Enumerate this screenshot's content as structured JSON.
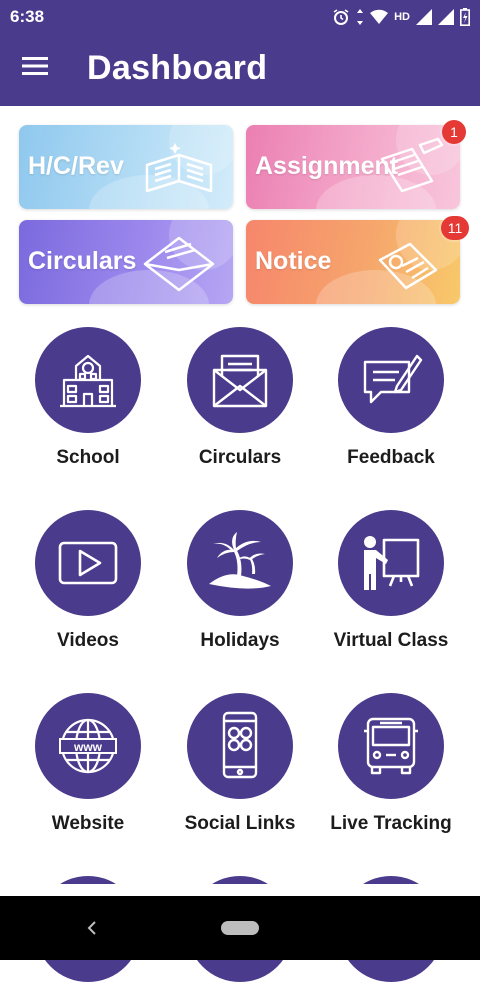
{
  "status_bar": {
    "time": "6:38",
    "network": "HD"
  },
  "app_bar": {
    "title": "Dashboard",
    "menu_icon": "hamburger-menu-icon"
  },
  "cards": [
    {
      "label": "H/C/Rev",
      "icon": "open-book-icon",
      "color": "#8fc8ee"
    },
    {
      "label": "Assignment",
      "icon": "notebook-pencil-icon",
      "color": "#eb7fb2",
      "badge": "1"
    },
    {
      "label": "Circulars",
      "icon": "envelope-icon",
      "color": "#7b6ade"
    },
    {
      "label": "Notice",
      "icon": "pinned-paper-icon",
      "color": "#f6866c",
      "badge": "11"
    }
  ],
  "grid": [
    {
      "label": "School",
      "icon": "school-building-icon"
    },
    {
      "label": "Circulars",
      "icon": "open-envelope-icon"
    },
    {
      "label": "Feedback",
      "icon": "feedback-bubble-icon"
    },
    {
      "label": "Videos",
      "icon": "play-icon"
    },
    {
      "label": "Holidays",
      "icon": "palm-island-icon"
    },
    {
      "label": "Virtual Class",
      "icon": "presentation-board-icon"
    },
    {
      "label": "Website",
      "icon": "globe-www-icon"
    },
    {
      "label": "Social Links",
      "icon": "phone-social-icon"
    },
    {
      "label": "Live Tracking",
      "icon": "bus-icon"
    }
  ],
  "colors": {
    "primary": "#4b3b8c",
    "badge": "#e53935",
    "label_text": "#1c1c1c"
  }
}
